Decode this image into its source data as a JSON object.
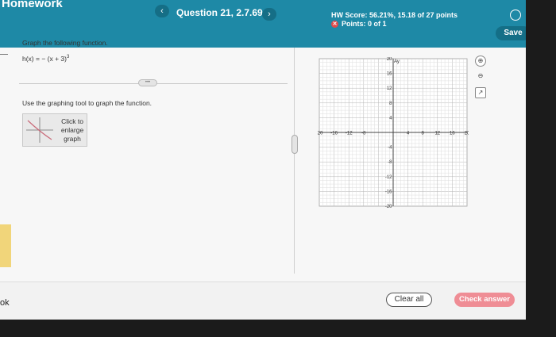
{
  "header": {
    "app_title": "Homework",
    "question_title": "Question 21, 2.7.69",
    "prev_label": "‹",
    "next_label": "›",
    "hw_score": "HW Score: 56.21%, 15.18 of 27 points",
    "points": "Points: 0 of 1",
    "save_label": "Save"
  },
  "problem": {
    "prompt": "Graph the following function.",
    "function_text": "h(x) = − (x + 3)",
    "function_exponent": "3",
    "instruction": "Use the graphing tool to graph the function.",
    "enlarge_label": "Click to enlarge graph"
  },
  "graph": {
    "x_label": "x",
    "y_label": "Ay",
    "x_ticks": [
      "-20",
      "-16",
      "-12",
      "-8",
      "4",
      "8",
      "12",
      "16",
      "20"
    ],
    "y_ticks": [
      "20",
      "16",
      "12",
      "8",
      "4",
      "-4",
      "-8",
      "-12",
      "-16",
      "-20"
    ],
    "range": [
      -20,
      20
    ],
    "grid": true
  },
  "footer": {
    "left_text": "ok",
    "clear_label": "Clear all",
    "check_label": "Check answer"
  },
  "colors": {
    "topbar": "#1e89a6",
    "check_button": "#ef8d95"
  }
}
